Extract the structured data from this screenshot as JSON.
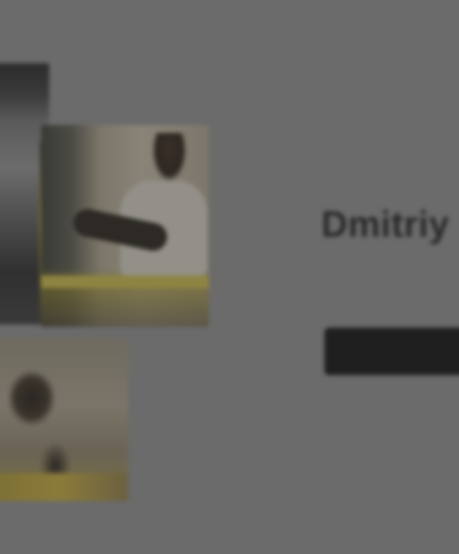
{
  "hero": {
    "title": "Dmitriy",
    "subtitle": "",
    "button_label": ""
  },
  "colors": {
    "background": "#6b6b6b",
    "title": "#2a2a2a",
    "button": "#1f1f1f"
  }
}
